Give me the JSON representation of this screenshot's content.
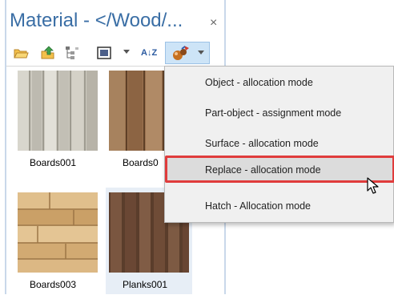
{
  "window": {
    "title": "Material - </Wood/...",
    "close_glyph": "×"
  },
  "toolbar": {
    "buttons": [
      {
        "icon": "open-folder-icon"
      },
      {
        "icon": "folder-up-icon"
      },
      {
        "icon": "tree-view-icon"
      },
      {
        "icon": "display-mode-icon"
      },
      {
        "icon": "sort-az-icon"
      },
      {
        "icon": "assign-material-icon"
      }
    ],
    "sort_glyph": "A↓Z"
  },
  "materials": [
    {
      "label": "Boards001"
    },
    {
      "label": "Boards0"
    },
    {
      "label": "Boards003"
    },
    {
      "label": "Planks001"
    }
  ],
  "menu": {
    "items": [
      {
        "label": "Object - allocation mode"
      },
      {
        "label": "Part-object - assignment mode"
      },
      {
        "label": "Surface - allocation mode"
      },
      {
        "label": "Replace - allocation mode"
      },
      {
        "label": "Hatch - Allocation mode"
      }
    ],
    "highlighted_index": 3
  },
  "colors": {
    "title": "#3a6ea5",
    "highlight_frame": "#e03c3c",
    "toolbar_active": "#cde4f7"
  }
}
